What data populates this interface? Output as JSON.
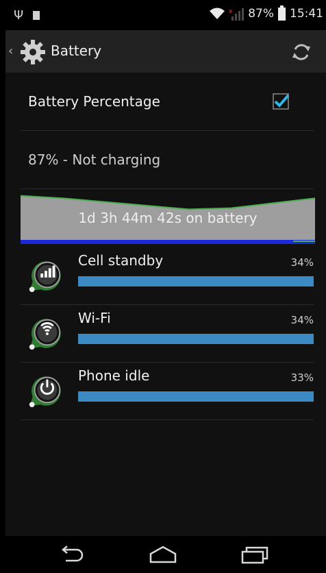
{
  "status_bar": {
    "battery_percent": "87%",
    "time": "15:41",
    "usb_glyph": "Ψ"
  },
  "app_bar": {
    "title": "Battery",
    "back_glyph": "‹"
  },
  "battery_percentage": {
    "label": "Battery Percentage",
    "checked": true
  },
  "battery_status": "87% - Not charging",
  "history": {
    "label": "1d 3h 44m 42s on battery",
    "battery_levels": [
      0.98,
      0.96,
      0.93,
      0.9,
      0.87,
      0.88,
      0.92,
      0.96
    ]
  },
  "usage": [
    {
      "name": "Cell standby",
      "percent": "34%",
      "fill": 1.0,
      "icon": "signal-bars-icon"
    },
    {
      "name": "Wi-Fi",
      "percent": "34%",
      "fill": 1.0,
      "icon": "wifi-icon"
    },
    {
      "name": "Phone idle",
      "percent": "33%",
      "fill": 1.0,
      "icon": "power-icon"
    }
  ],
  "colors": {
    "bar": "#3c8ac3",
    "check": "#33b5e5",
    "graph_line": "#4caf50",
    "graph_fill": "#9e9e9e",
    "graph_base": "#1a2ad8"
  }
}
